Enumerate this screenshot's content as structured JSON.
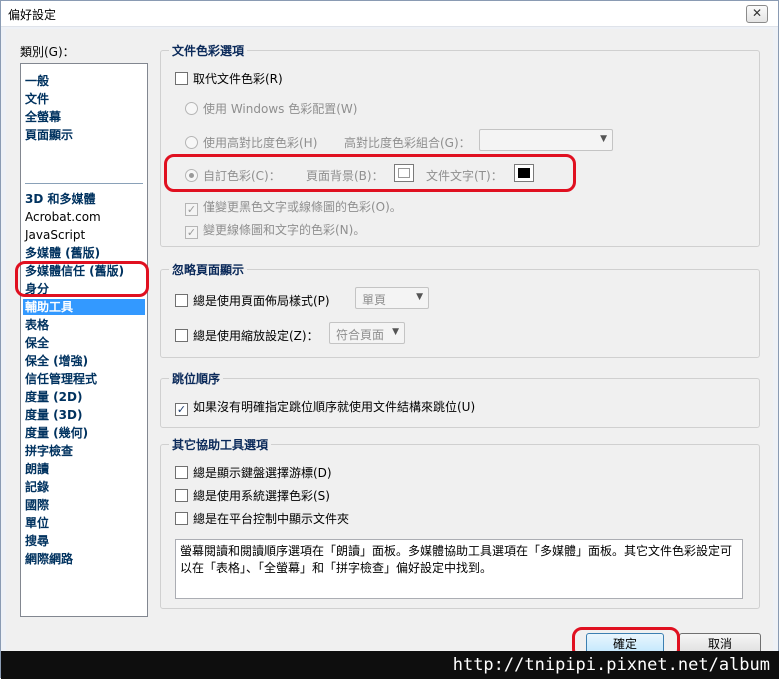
{
  "window": {
    "title": "偏好設定",
    "close_glyph": "✕"
  },
  "categories": {
    "label": "類別(G)：",
    "group1": [
      "一般",
      "文件",
      "全螢幕",
      "頁面顯示"
    ],
    "group2": [
      "3D 和多媒體",
      "Acrobat.com",
      "JavaScript",
      "多媒體 (舊版)",
      "多媒體信任 (舊版)",
      "身分",
      "輔助工具",
      "表格",
      "保全",
      "保全 (增強)",
      "信任管理程式",
      "度量 (2D)",
      "度量 (3D)",
      "度量 (幾何)",
      "拼字檢查",
      "朗讀",
      "記錄",
      "國際",
      "單位",
      "搜尋",
      "網際網路"
    ],
    "selected": "輔助工具"
  },
  "doc_colors": {
    "title": "文件色彩選項",
    "replace_label": "取代文件色彩(R)",
    "windows_colors_label": "使用 Windows 色彩配置(W)",
    "high_contrast_label": "使用高對比度色彩(H)",
    "high_contrast_combo_label": "高對比度色彩組合(G)：",
    "high_contrast_combo_value": "",
    "custom_label": "自訂色彩(C)：",
    "page_bg_label": "頁面背景(B)：",
    "doc_text_label": "文件文字(T)：",
    "page_bg_color": "#ffffff",
    "doc_text_color": "#000000",
    "only_black_label": "僅變更黑色文字或線條圖的色彩(O)。",
    "change_line_label": "變更線條圖和文字的色彩(N)。"
  },
  "page_display": {
    "title": "忽略頁面顯示",
    "layout_label": "總是使用頁面佈局樣式(P)",
    "layout_value": "單頁",
    "zoom_label": "總是使用縮放設定(Z)：",
    "zoom_value": "符合頁面"
  },
  "tab_order": {
    "title": "跳位順序",
    "use_structure_label": "如果沒有明確指定跳位順序就使用文件結構來跳位(U)"
  },
  "other_options": {
    "title": "其它協助工具選項",
    "keyboard_cursor_label": "總是顯示鍵盤選擇游標(D)",
    "system_colors_label": "總是使用系統選擇色彩(S)",
    "show_docs_label": "總是在平台控制中顯示文件夾"
  },
  "description": "螢幕閱讀和閱讀順序選項在「朗讀」面板。多媒體協助工具選項在「多媒體」面板。其它文件色彩設定可以在「表格」、「全螢幕」和「拼字檢查」偏好設定中找到。",
  "buttons": {
    "ok": "確定",
    "cancel": "取消"
  },
  "watermark": "http://tnipipi.pixnet.net/album",
  "colors": {
    "highlight": "#e01020",
    "selection": "#3399ff"
  }
}
